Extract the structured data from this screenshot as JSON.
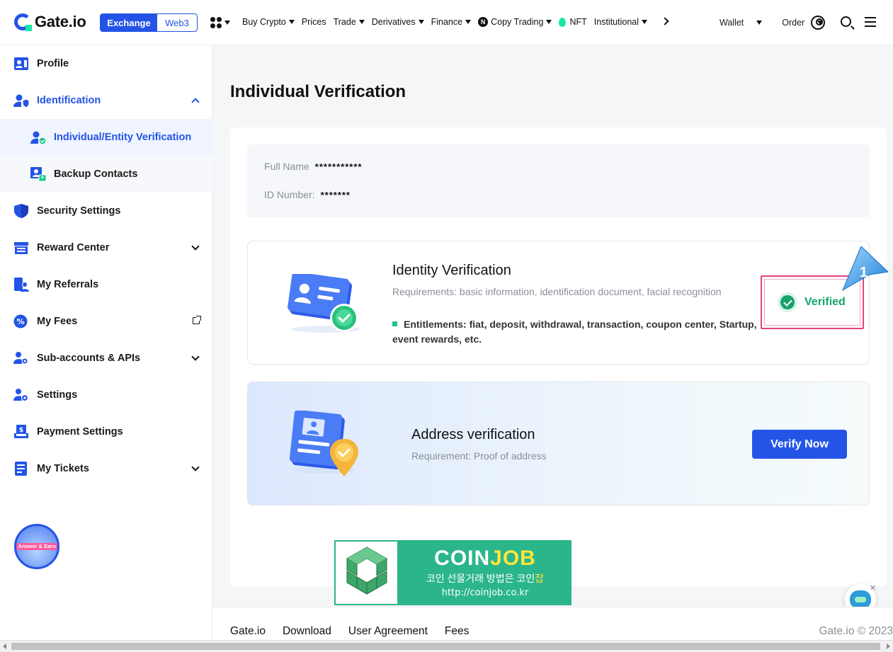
{
  "brand": {
    "name": "Gate.io",
    "color": "#2354e6",
    "accent": "#17e7a6"
  },
  "topnav": {
    "segments": [
      "Exchange",
      "Web3"
    ],
    "active_segment": "Exchange",
    "menu": [
      {
        "label": "Buy Crypto",
        "dropdown": true
      },
      {
        "label": "Prices",
        "dropdown": false
      },
      {
        "label": "Trade",
        "dropdown": true
      },
      {
        "label": "Derivatives",
        "dropdown": true
      },
      {
        "label": "Finance",
        "dropdown": true
      },
      {
        "label": "Copy Trading",
        "dropdown": true,
        "icon": "copy-trading-icon"
      },
      {
        "label": "NFT",
        "dropdown": false,
        "icon": "nft-flame-icon"
      },
      {
        "label": "Institutional",
        "dropdown": true
      }
    ],
    "right": [
      "Wallet",
      "Order"
    ],
    "icons": [
      "apps-grid-icon",
      "chevron-right-icon",
      "user-account-icon",
      "search-icon",
      "hamburger-menu-icon"
    ]
  },
  "sidebar": {
    "items": [
      {
        "label": "Profile",
        "icon": "profile-card-icon"
      },
      {
        "label": "Identification",
        "icon": "identification-icon",
        "expanded": true
      },
      {
        "label": "Individual/Entity Verification",
        "icon": "verified-user-icon",
        "selected": true
      },
      {
        "label": "Backup Contacts",
        "icon": "backup-contacts-icon"
      },
      {
        "label": "Security Settings",
        "icon": "shield-icon"
      },
      {
        "label": "Reward Center",
        "icon": "reward-icon"
      },
      {
        "label": "My Referrals",
        "icon": "referrals-icon"
      },
      {
        "label": "My Fees",
        "icon": "fees-percent-icon"
      },
      {
        "label": "Sub-accounts & APIs",
        "icon": "sub-accounts-icon"
      },
      {
        "label": "Settings",
        "icon": "user-settings-icon"
      },
      {
        "label": "Payment Settings",
        "icon": "payment-icon"
      },
      {
        "label": "My Tickets",
        "icon": "tickets-icon"
      }
    ],
    "promo_badge": {
      "tag": "Answer & Earn",
      "icon": "answer-earn-badge"
    }
  },
  "main": {
    "title": "Individual Verification",
    "full_name_label": "Full Name",
    "full_name_value": "***********",
    "id_number_label": "ID Number:",
    "id_number_value": "*******",
    "identity": {
      "title": "Identity Verification",
      "requirements": "Requirements: basic information, identification document, facial recognition",
      "entitlements": "Entitlements: fiat, deposit, withdrawal, transaction, coupon center, Startup, event rewards, etc.",
      "status": "Verified",
      "status_color": "#17a36b",
      "annotation_number": "1"
    },
    "address": {
      "title": "Address verification",
      "requirement": "Requirement: Proof of address",
      "button": "Verify Now"
    }
  },
  "watermark": {
    "title_white": "COIN",
    "title_yellow": "JOB",
    "subtitle_white": "코인 선물거래 방법은 코인",
    "subtitle_yellow": "잡",
    "url": "http://coinjob.co.kr"
  },
  "footer": {
    "links": [
      "Gate.io",
      "Download",
      "User Agreement",
      "Fees"
    ],
    "copyright": "Gate.io © 2023"
  }
}
